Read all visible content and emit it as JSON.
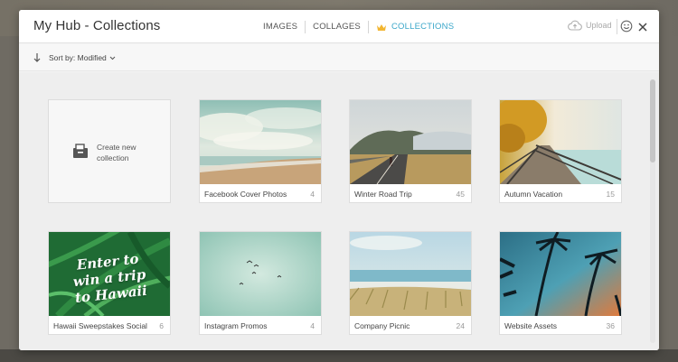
{
  "header": {
    "title": "My Hub - Collections",
    "tabs": [
      {
        "label": "IMAGES"
      },
      {
        "label": "COLLAGES"
      },
      {
        "label": "COLLECTIONS",
        "active": true
      }
    ],
    "upload_label": "Upload"
  },
  "toolbar": {
    "sort_label": "Sort by: Modified"
  },
  "new_collection": {
    "label_line1": "Create new",
    "label_line2": "collection"
  },
  "collections": [
    {
      "name": "Facebook Cover Photos",
      "count": "4"
    },
    {
      "name": "Winter Road Trip",
      "count": "45"
    },
    {
      "name": "Autumn Vacation",
      "count": "15"
    },
    {
      "name": "Hawaii Sweepstakes Social",
      "count": "6",
      "thumb_text": [
        "Enter to",
        "win a trip",
        "to Hawaii"
      ]
    },
    {
      "name": "Instagram Promos",
      "count": "4"
    },
    {
      "name": "Company Picnic",
      "count": "24"
    },
    {
      "name": "Website Assets",
      "count": "36"
    }
  ],
  "colors": {
    "accent": "#3aa6c9",
    "crown": "#f2b632"
  }
}
